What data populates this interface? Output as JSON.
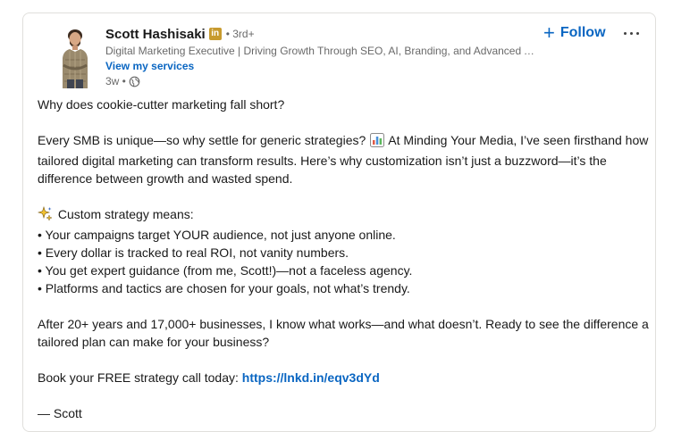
{
  "author": {
    "name": "Scott Hashisaki",
    "badge_icon": "linkedin-premium-badge-icon",
    "badge_text": "in",
    "degree": "• 3rd+",
    "headline": "Digital Marketing Executive | Driving Growth Through SEO, AI, Branding, and Advanced A...",
    "services_link": "View my services",
    "time": "3w •",
    "visibility_icon": "globe-icon"
  },
  "actions": {
    "follow_label": "Follow",
    "follow_icon": "+",
    "more_icon": "ellipsis-icon"
  },
  "post": {
    "line1": "Why does cookie-cutter marketing fall short?",
    "para2_a": "Every SMB is unique—so why settle for generic strategies?",
    "para2_b": "At Minding Your Media, I’ve seen firsthand how tailored digital marketing can transform results. Here’s why customization isn’t just a buzzword—it’s the difference between growth and wasted spend.",
    "strategy_heading": "Custom strategy means:",
    "bullets": [
      "• Your campaigns target YOUR audience, not just anyone online.",
      "• Every dollar is tracked to real ROI, not vanity numbers.",
      "• You get expert guidance (from me, Scott!)—not a faceless agency.",
      "• Platforms and tactics are chosen for your goals, not what’s trendy."
    ],
    "para4": "After 20+ years and 17,000+ businesses, I know what works—and what doesn’t. Ready to see the difference a tailored plan can make for your business?",
    "cta_text": "Book your FREE strategy call today:",
    "cta_link": "https://lnkd.in/eqv3dYd",
    "signoff": "— Scott"
  },
  "colors": {
    "link_blue": "#0a66c2",
    "muted_text": "rgba(0,0,0,0.6)",
    "border": "#e0dfdc"
  }
}
